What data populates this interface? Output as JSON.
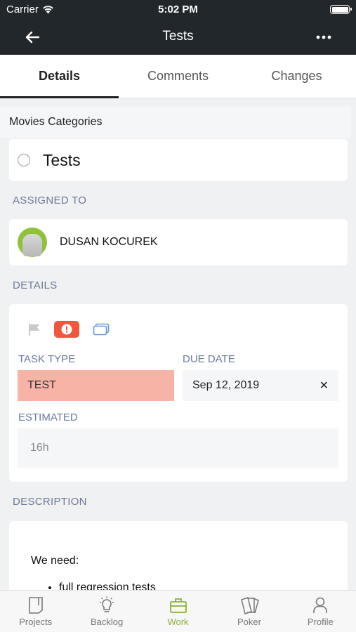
{
  "status_bar": {
    "carrier": "Carrier",
    "time": "5:02 PM"
  },
  "nav": {
    "title": "Tests",
    "back_icon": "arrow-left-icon",
    "more_icon": "more-dots-icon"
  },
  "tabs": [
    {
      "label": "Details",
      "active": true
    },
    {
      "label": "Comments",
      "active": false
    },
    {
      "label": "Changes",
      "active": false
    }
  ],
  "task": {
    "project": "Movies Categories",
    "title": "Tests",
    "assigned_label": "ASSIGNED TO",
    "assignee": "DUSAN KOCUREK",
    "details_label": "DETAILS",
    "task_type_label": "TASK TYPE",
    "task_type": "TEST",
    "due_date_label": "DUE DATE",
    "due_date": "Sep 12, 2019",
    "estimated_label": "ESTIMATED",
    "estimated": "16h",
    "description_label": "DESCRIPTION",
    "description_intro": "We need:",
    "description_items": [
      "full regression tests"
    ]
  },
  "colors": {
    "accent": "#86b13b",
    "priority": "#f0583e",
    "task_type_bg": "#f8b3a7",
    "header": "#21272b"
  },
  "bottom_tabs": [
    {
      "label": "Projects",
      "icon": "projects-icon",
      "active": false
    },
    {
      "label": "Backlog",
      "icon": "lightbulb-icon",
      "active": false
    },
    {
      "label": "Work",
      "icon": "briefcase-icon",
      "active": true
    },
    {
      "label": "Poker",
      "icon": "cards-icon",
      "active": false
    },
    {
      "label": "Profile",
      "icon": "person-icon",
      "active": false
    }
  ]
}
